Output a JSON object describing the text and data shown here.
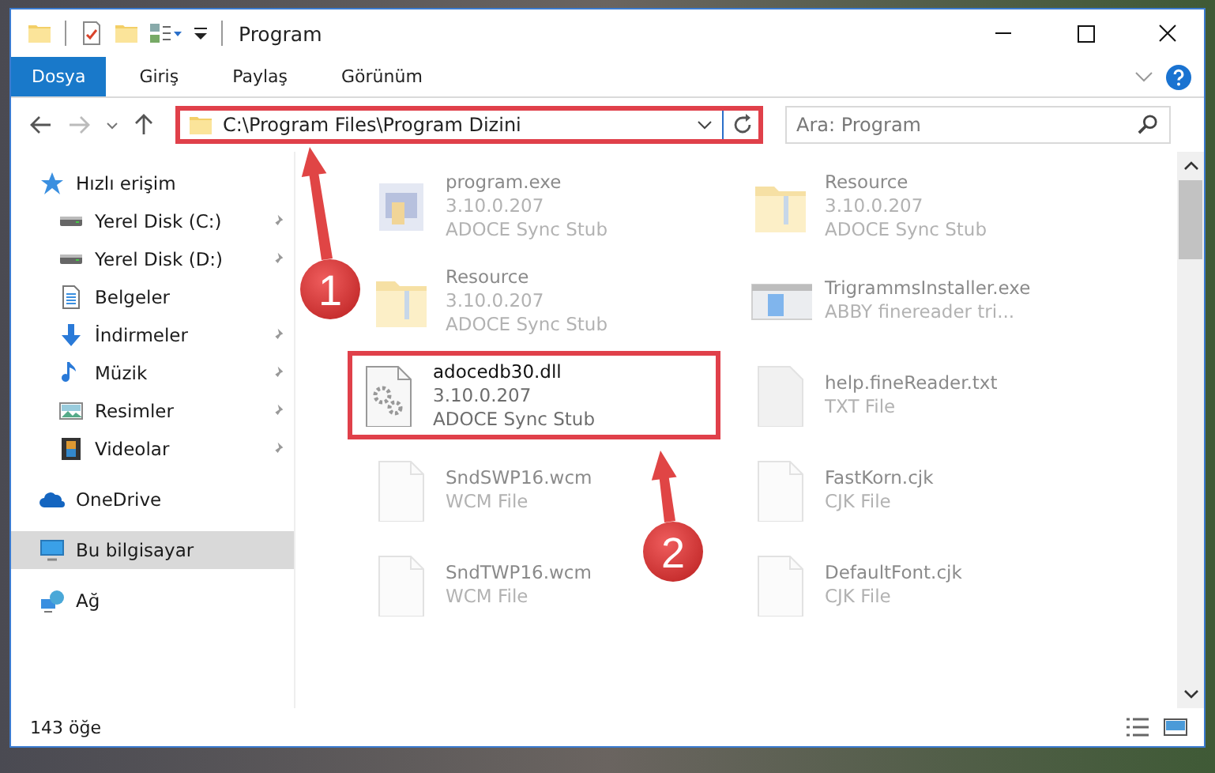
{
  "window": {
    "title": "Program"
  },
  "ribbon_tabs": [
    {
      "label": "Dosya",
      "selected": true
    },
    {
      "label": "Giriş",
      "selected": false
    },
    {
      "label": "Paylaş",
      "selected": false
    },
    {
      "label": "Görünüm",
      "selected": false
    }
  ],
  "address_bar": {
    "path": "C:\\Program Files\\Program Dizini",
    "highlighted": true
  },
  "search": {
    "placeholder": "Ara: Program"
  },
  "sidebar": {
    "items": [
      {
        "label": "Hızlı erişim",
        "kind": "star",
        "selected": false,
        "children": [
          {
            "label": "Yerel Disk (C:)",
            "kind": "drive",
            "pinned": true,
            "selected": false
          },
          {
            "label": "Yerel Disk (D:)",
            "kind": "drive",
            "pinned": true,
            "selected": false
          },
          {
            "label": "Belgeler",
            "kind": "document",
            "pinned": false,
            "selected": false
          },
          {
            "label": "İndirmeler",
            "kind": "download",
            "pinned": true,
            "selected": false
          },
          {
            "label": "Müzik",
            "kind": "music",
            "pinned": true,
            "selected": false
          },
          {
            "label": "Resimler",
            "kind": "picture",
            "pinned": true,
            "selected": false
          },
          {
            "label": "Videolar",
            "kind": "film",
            "pinned": true,
            "selected": false
          }
        ]
      },
      {
        "label": "OneDrive",
        "kind": "cloud",
        "selected": false
      },
      {
        "label": "Bu bilgisayar",
        "kind": "monitor",
        "selected": true
      },
      {
        "label": "Ağ",
        "kind": "network",
        "selected": false
      }
    ]
  },
  "files": [
    {
      "name": "program.exe",
      "details": [
        "3.10.0.207",
        "ADOCE Sync Stub"
      ],
      "kind": "exe",
      "blurred": true,
      "highlighted": false
    },
    {
      "name": "Resource",
      "details": [
        "3.10.0.207",
        "ADOCE Sync Stub"
      ],
      "kind": "folder",
      "blurred": true,
      "highlighted": false
    },
    {
      "name": "Resource",
      "details": [
        "3.10.0.207",
        "ADOCE Sync Stub"
      ],
      "kind": "folder",
      "blurred": true,
      "highlighted": false
    },
    {
      "name": "TrigrammsInstaller.exe",
      "details": [
        "ABBY finereader tri..."
      ],
      "kind": "installer",
      "blurred": true,
      "highlighted": false
    },
    {
      "name": "adocedb30.dll",
      "details": [
        "3.10.0.207",
        "ADOCE Sync Stub"
      ],
      "kind": "dll",
      "blurred": false,
      "highlighted": true
    },
    {
      "name": "help.fineReader.txt",
      "details": [
        "TXT File"
      ],
      "kind": "txt",
      "blurred": true,
      "highlighted": false
    },
    {
      "name": "SndSWP16.wcm",
      "details": [
        "WCM File"
      ],
      "kind": "file",
      "blurred": true,
      "highlighted": false
    },
    {
      "name": "FastKorn.cjk",
      "details": [
        "CJK File"
      ],
      "kind": "file",
      "blurred": true,
      "highlighted": false
    },
    {
      "name": "SndTWP16.wcm",
      "details": [
        "WCM File"
      ],
      "kind": "file",
      "blurred": true,
      "highlighted": false
    },
    {
      "name": "DefaultFont.cjk",
      "details": [
        "CJK File"
      ],
      "kind": "file",
      "blurred": true,
      "highlighted": false
    }
  ],
  "status_bar": {
    "item_count": "143 öğe"
  },
  "annotations": [
    {
      "label": "1"
    },
    {
      "label": "2"
    }
  ]
}
